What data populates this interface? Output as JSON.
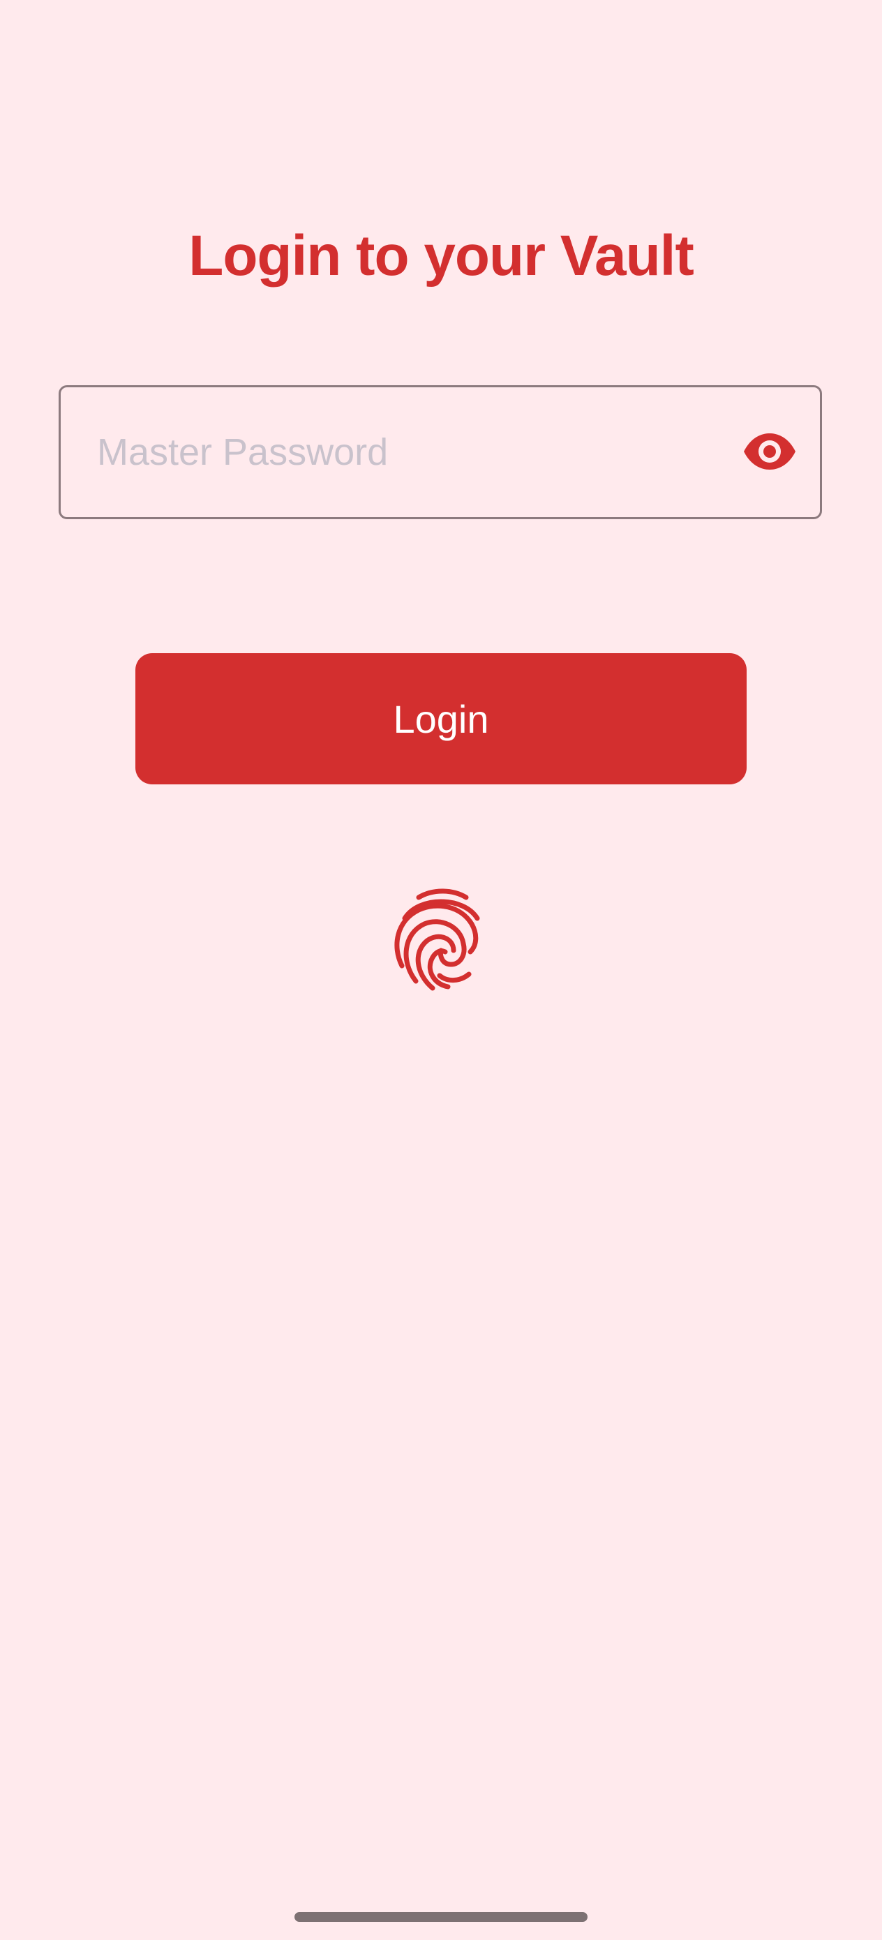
{
  "colors": {
    "background": "#FFEAED",
    "accent": "#D32F2F",
    "field_border": "#8C7A7E",
    "placeholder": "#C9C2CC",
    "button_text": "#FFFFFF"
  },
  "login": {
    "title": "Login to your Vault",
    "password_placeholder": "Master Password",
    "password_value": "",
    "button_label": "Login"
  },
  "icons": {
    "visibility_toggle": "eye-icon",
    "biometric": "fingerprint-icon"
  }
}
